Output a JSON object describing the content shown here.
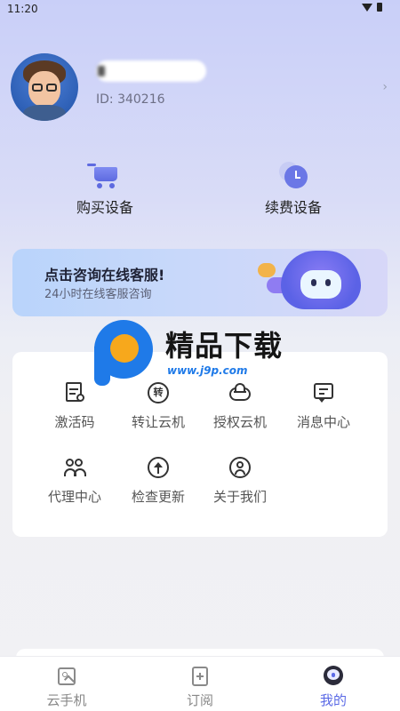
{
  "status_bar": {
    "time": "11:20"
  },
  "profile": {
    "user_id": "ID: 340216",
    "chevron": "›"
  },
  "quick_actions": [
    {
      "label": "购买设备",
      "icon": "cart-icon"
    },
    {
      "label": "续费设备",
      "icon": "clock-icon"
    }
  ],
  "service_banner": {
    "title": "点击咨询在线客服!",
    "subtitle": "24小时在线客服咨询"
  },
  "watermark": {
    "title": "精品下载",
    "url": "www.j9p.com"
  },
  "menu": {
    "items": [
      {
        "label": "激活码",
        "icon": "activation-code-icon"
      },
      {
        "label": "转让云机",
        "icon": "transfer-icon"
      },
      {
        "label": "授权云机",
        "icon": "cloud-authorize-icon"
      },
      {
        "label": "消息中心",
        "icon": "message-icon"
      },
      {
        "label": "代理中心",
        "icon": "agent-icon"
      },
      {
        "label": "检查更新",
        "icon": "update-icon"
      },
      {
        "label": "关于我们",
        "icon": "about-icon"
      }
    ],
    "transfer_glyph": "转"
  },
  "tabbar": {
    "tabs": [
      {
        "label": "云手机",
        "icon": "cloud-phone-icon",
        "active": false
      },
      {
        "label": "订阅",
        "icon": "subscribe-icon",
        "active": false
      },
      {
        "label": "我的",
        "icon": "mine-icon",
        "active": true
      }
    ],
    "active_color": "#5b6ae6"
  },
  "colors": {
    "accent": "#5e6ae0",
    "banner_gradient_start": "#b9d4fb",
    "banner_gradient_end": "#d7d7f8"
  }
}
